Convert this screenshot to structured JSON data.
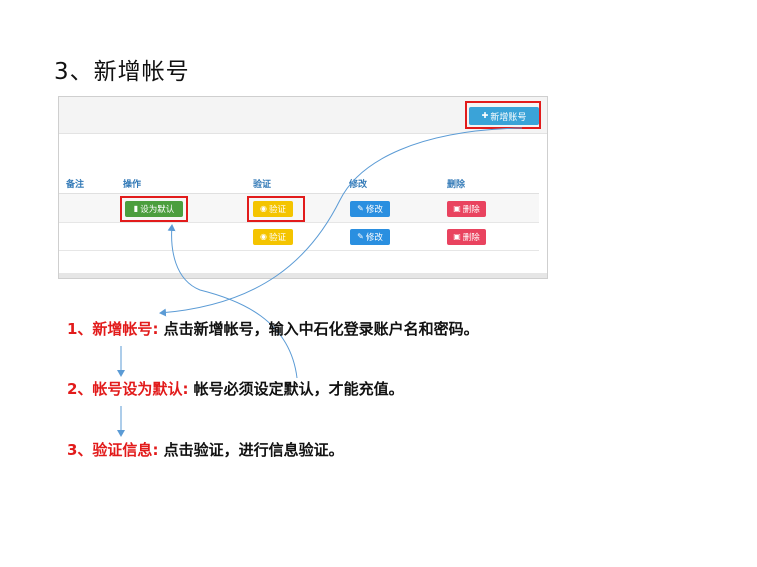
{
  "title": "3、新增帐号",
  "toolbar": {
    "add_icon": "plus-icon",
    "add_label": "新增账号"
  },
  "table": {
    "headers": [
      "备注",
      "操作",
      "验证",
      "修改",
      "删除"
    ],
    "rows": [
      {
        "default_label": "设为默认",
        "verify_label": "验证",
        "edit_label": "修改",
        "delete_label": "删除"
      },
      {
        "verify_label": "验证",
        "edit_label": "修改",
        "delete_label": "删除"
      }
    ]
  },
  "steps": [
    {
      "label": "1、新增帐号:",
      "desc": "点击新增帐号，输入中石化登录账户名和密码。"
    },
    {
      "label": "2、帐号设为默认:",
      "desc": "帐号必须设定默认，才能充值。"
    },
    {
      "label": "3、验证信息:",
      "desc": "点击验证，进行信息验证。"
    }
  ],
  "colors": {
    "highlight": "#e21b1b",
    "add_button": "#3aa3d8",
    "default_button": "#4c9e3e",
    "verify_button": "#f4c400",
    "edit_button": "#2a8fe0",
    "delete_button": "#e9435f",
    "header_text": "#337ab7",
    "arrow": "#5b9bd5"
  }
}
